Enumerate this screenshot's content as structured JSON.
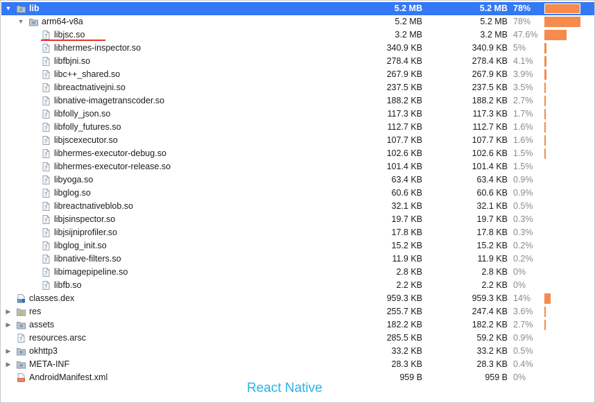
{
  "rows": [
    {
      "name": "lib",
      "raw": "5.2 MB",
      "download": "5.2 MB",
      "pct": "78%",
      "bar": 0.78,
      "level": 0,
      "arrow": "open",
      "icon": "folder",
      "selected": true
    },
    {
      "name": "arm64-v8a",
      "raw": "5.2 MB",
      "download": "5.2 MB",
      "pct": "78%",
      "bar": 0.78,
      "level": 1,
      "arrow": "open",
      "icon": "folder"
    },
    {
      "name": "libjsc.so",
      "raw": "3.2 MB",
      "download": "3.2 MB",
      "pct": "47.6%",
      "bar": 0.476,
      "level": 2,
      "arrow": "none",
      "icon": "file"
    },
    {
      "name": "libhermes-inspector.so",
      "raw": "340.9 KB",
      "download": "340.9 KB",
      "pct": "5%",
      "bar": 0.05,
      "level": 2,
      "arrow": "none",
      "icon": "file"
    },
    {
      "name": "libfbjni.so",
      "raw": "278.4 KB",
      "download": "278.4 KB",
      "pct": "4.1%",
      "bar": 0.041,
      "level": 2,
      "arrow": "none",
      "icon": "file"
    },
    {
      "name": "libc++_shared.so",
      "raw": "267.9 KB",
      "download": "267.9 KB",
      "pct": "3.9%",
      "bar": 0.039,
      "level": 2,
      "arrow": "none",
      "icon": "file"
    },
    {
      "name": "libreactnativejni.so",
      "raw": "237.5 KB",
      "download": "237.5 KB",
      "pct": "3.5%",
      "bar": 0.035,
      "level": 2,
      "arrow": "none",
      "icon": "file"
    },
    {
      "name": "libnative-imagetranscoder.so",
      "raw": "188.2 KB",
      "download": "188.2 KB",
      "pct": "2.7%",
      "bar": 0.027,
      "level": 2,
      "arrow": "none",
      "icon": "file"
    },
    {
      "name": "libfolly_json.so",
      "raw": "117.3 KB",
      "download": "117.3 KB",
      "pct": "1.7%",
      "bar": 0.017,
      "level": 2,
      "arrow": "none",
      "icon": "file"
    },
    {
      "name": "libfolly_futures.so",
      "raw": "112.7 KB",
      "download": "112.7 KB",
      "pct": "1.6%",
      "bar": 0.016,
      "level": 2,
      "arrow": "none",
      "icon": "file"
    },
    {
      "name": "libjscexecutor.so",
      "raw": "107.7 KB",
      "download": "107.7 KB",
      "pct": "1.6%",
      "bar": 0.016,
      "level": 2,
      "arrow": "none",
      "icon": "file"
    },
    {
      "name": "libhermes-executor-debug.so",
      "raw": "102.6 KB",
      "download": "102.6 KB",
      "pct": "1.5%",
      "bar": 0.015,
      "level": 2,
      "arrow": "none",
      "icon": "file"
    },
    {
      "name": "libhermes-executor-release.so",
      "raw": "101.4 KB",
      "download": "101.4 KB",
      "pct": "1.5%",
      "bar": 0,
      "level": 2,
      "arrow": "none",
      "icon": "file"
    },
    {
      "name": "libyoga.so",
      "raw": "63.4 KB",
      "download": "63.4 KB",
      "pct": "0.9%",
      "bar": 0,
      "level": 2,
      "arrow": "none",
      "icon": "file"
    },
    {
      "name": "libglog.so",
      "raw": "60.6 KB",
      "download": "60.6 KB",
      "pct": "0.9%",
      "bar": 0,
      "level": 2,
      "arrow": "none",
      "icon": "file"
    },
    {
      "name": "libreactnativeblob.so",
      "raw": "32.1 KB",
      "download": "32.1 KB",
      "pct": "0.5%",
      "bar": 0,
      "level": 2,
      "arrow": "none",
      "icon": "file"
    },
    {
      "name": "libjsinspector.so",
      "raw": "19.7 KB",
      "download": "19.7 KB",
      "pct": "0.3%",
      "bar": 0,
      "level": 2,
      "arrow": "none",
      "icon": "file"
    },
    {
      "name": "libjsijniprofiler.so",
      "raw": "17.8 KB",
      "download": "17.8 KB",
      "pct": "0.3%",
      "bar": 0,
      "level": 2,
      "arrow": "none",
      "icon": "file"
    },
    {
      "name": "libglog_init.so",
      "raw": "15.2 KB",
      "download": "15.2 KB",
      "pct": "0.2%",
      "bar": 0,
      "level": 2,
      "arrow": "none",
      "icon": "file"
    },
    {
      "name": "libnative-filters.so",
      "raw": "11.9 KB",
      "download": "11.9 KB",
      "pct": "0.2%",
      "bar": 0,
      "level": 2,
      "arrow": "none",
      "icon": "file"
    },
    {
      "name": "libimagepipeline.so",
      "raw": "2.8 KB",
      "download": "2.8 KB",
      "pct": "0%",
      "bar": 0,
      "level": 2,
      "arrow": "none",
      "icon": "file"
    },
    {
      "name": "libfb.so",
      "raw": "2.2 KB",
      "download": "2.2 KB",
      "pct": "0%",
      "bar": 0,
      "level": 2,
      "arrow": "none",
      "icon": "file"
    },
    {
      "name": "classes.dex",
      "raw": "959.3 KB",
      "download": "959.3 KB",
      "pct": "14%",
      "bar": 0.14,
      "level": 0,
      "arrow": "none",
      "icon": "dex"
    },
    {
      "name": "res",
      "raw": "255.7 KB",
      "download": "247.4 KB",
      "pct": "3.6%",
      "bar": 0.036,
      "level": 0,
      "arrow": "closed",
      "icon": "res"
    },
    {
      "name": "assets",
      "raw": "182.2 KB",
      "download": "182.2 KB",
      "pct": "2.7%",
      "bar": 0.027,
      "level": 0,
      "arrow": "closed",
      "icon": "folder"
    },
    {
      "name": "resources.arsc",
      "raw": "285.5 KB",
      "download": "59.2 KB",
      "pct": "0.9%",
      "bar": 0,
      "level": 0,
      "arrow": "none",
      "icon": "file"
    },
    {
      "name": "okhttp3",
      "raw": "33.2 KB",
      "download": "33.2 KB",
      "pct": "0.5%",
      "bar": 0,
      "level": 0,
      "arrow": "closed",
      "icon": "folder"
    },
    {
      "name": "META-INF",
      "raw": "28.3 KB",
      "download": "28.3 KB",
      "pct": "0.4%",
      "bar": 0,
      "level": 0,
      "arrow": "closed",
      "icon": "folder"
    },
    {
      "name": "AndroidManifest.xml",
      "raw": "959 B",
      "download": "959 B",
      "pct": "0%",
      "bar": 0,
      "level": 0,
      "arrow": "none",
      "icon": "xml"
    }
  ],
  "caption": "React Native",
  "colors": {
    "selection": "#3478f6",
    "bar": "#f58b4c",
    "caption": "#27b3ea",
    "annotation": "#e8312a"
  }
}
